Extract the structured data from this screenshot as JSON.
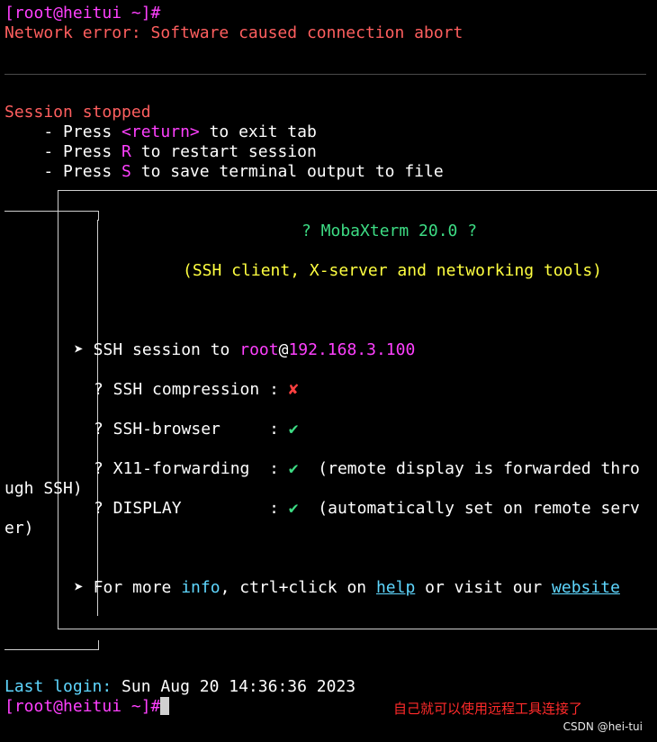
{
  "terminal": {
    "prompt_open": "[root@heitui ~]#",
    "network_error": "Network error: Software caused connection abort",
    "session_stopped": "Session stopped",
    "options": [
      {
        "prefix": "    - Press ",
        "key": "<return>",
        "suffix": " to exit tab"
      },
      {
        "prefix": "    - Press ",
        "key": "R",
        "suffix": " to restart session"
      },
      {
        "prefix": "    - Press ",
        "key": "S",
        "suffix": " to save terminal output to file"
      }
    ]
  },
  "banner": {
    "title": "? MobaXterm 20.0 ?",
    "subtitle": "(SSH client, X-server and networking tools)",
    "ssh_session_prefix": "➤ SSH session to ",
    "ssh_user": "root",
    "ssh_at": "@",
    "ssh_host": "192.168.3.100",
    "features": [
      {
        "label": "? SSH compression : ",
        "mark": "✘",
        "note": ""
      },
      {
        "label": "? SSH-browser     : ",
        "mark": "✔",
        "note": ""
      },
      {
        "label": "? X11-forwarding  : ",
        "mark": "✔",
        "note": "  (remote display is forwarded thro"
      },
      {
        "label": "? DISPLAY         : ",
        "mark": "✔",
        "note": "  (automatically set on remote serv"
      }
    ],
    "x11_wrap": "ugh SSH)",
    "display_wrap": "er)",
    "more_prefix": "➤ For more ",
    "more_info": "info",
    "more_mid": ", ctrl+click on ",
    "more_help": "help",
    "more_mid2": " or visit our ",
    "more_website": "website"
  },
  "login": {
    "label": "Last login:",
    "value": " Sun Aug 20 14:36:36 2023",
    "prompt": "[root@heitui ~]#"
  },
  "annotation": "自己就可以使用远程工具连接了",
  "watermark": "CSDN @hei-tui"
}
